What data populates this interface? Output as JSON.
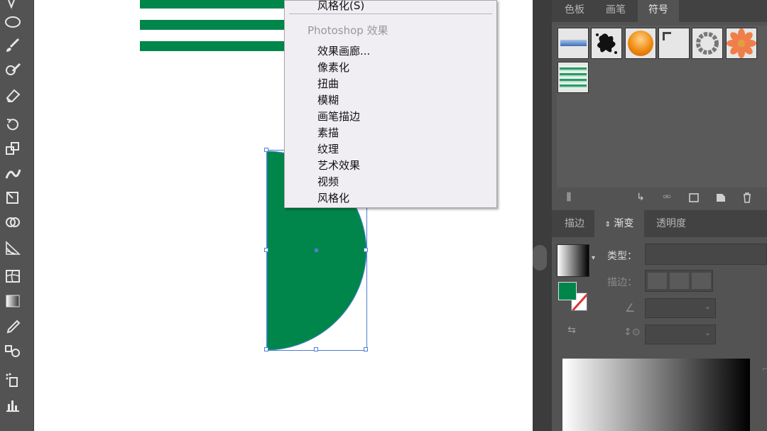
{
  "menu": {
    "top_item": "风格化(S)",
    "section_header": "Photoshop 效果",
    "items": [
      "效果画廊...",
      "像素化",
      "扭曲",
      "模糊",
      "画笔描边",
      "素描",
      "纹理",
      "艺术效果",
      "视频",
      "风格化"
    ]
  },
  "panels": {
    "top_tabs": [
      "色板",
      "画笔",
      "符号"
    ],
    "top_active_tab": "符号",
    "bottom_tabs": [
      "描边",
      "渐变",
      "透明度"
    ],
    "bottom_active_tab": "渐变",
    "gradient": {
      "type_label": "类型：",
      "stroke_label": "描边：",
      "type_value": ""
    }
  },
  "colors": {
    "shape_fill": "#00864a",
    "toolbar_bg": "#535353",
    "panel_bg": "#535353",
    "menu_bg": "#f1eef3",
    "selection": "#4c7fd4"
  },
  "tools": [
    "ellipse-tool-icon",
    "paintbrush-tool-icon",
    "blob-brush-tool-icon",
    "eraser-tool-icon",
    "rotate-tool-icon",
    "scale-tool-icon",
    "warp-tool-icon",
    "free-transform-tool-icon",
    "shape-builder-tool-icon",
    "perspective-grid-tool-icon",
    "mesh-tool-icon",
    "gradient-tool-icon",
    "eyedropper-tool-icon",
    "blend-tool-icon",
    "symbol-sprayer-tool-icon",
    "column-graph-tool-icon"
  ]
}
